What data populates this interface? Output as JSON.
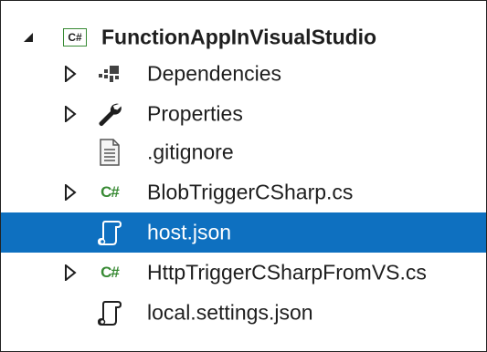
{
  "tree": {
    "project": {
      "name": "FunctionAppInVisualStudio",
      "icon": "csharp-project-icon",
      "expanded": true,
      "icon_text": "C#"
    },
    "items": [
      {
        "label": "Dependencies",
        "icon": "dependencies-icon",
        "expandable": true
      },
      {
        "label": "Properties",
        "icon": "wrench-icon",
        "expandable": true
      },
      {
        "label": ".gitignore",
        "icon": "text-file-icon",
        "expandable": false
      },
      {
        "label": "BlobTriggerCSharp.cs",
        "icon": "csharp-file-icon",
        "expandable": true,
        "icon_text": "C#"
      },
      {
        "label": "host.json",
        "icon": "json-file-icon",
        "expandable": false,
        "selected": true
      },
      {
        "label": "HttpTriggerCSharpFromVS.cs",
        "icon": "csharp-file-icon",
        "expandable": true,
        "icon_text": "C#"
      },
      {
        "label": "local.settings.json",
        "icon": "json-file-icon",
        "expandable": false
      }
    ]
  },
  "colors": {
    "selection": "#0e70c0",
    "csharp_green": "#388a34",
    "text": "#1e1e1e"
  }
}
